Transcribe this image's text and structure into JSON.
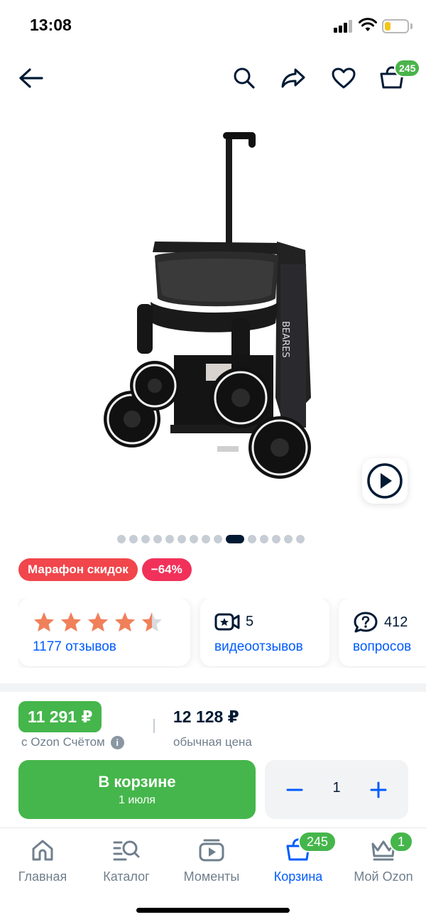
{
  "status_bar": {
    "time": "13:08",
    "battery_level": 0.25,
    "battery_color": "#f5c518"
  },
  "nav": {
    "back_icon": "arrow-left-icon",
    "icons": [
      "search-icon",
      "share-icon",
      "heart-icon",
      "cart-icon"
    ],
    "cart_count": "245"
  },
  "product": {
    "image": "folded black stroller",
    "brand_text": "BEARES",
    "video_icon": "play-icon"
  },
  "gallery": {
    "total_dots": 15,
    "active_index": 9
  },
  "badges": {
    "marathon": "Марафон скидок",
    "discount": "−64%"
  },
  "cards": {
    "rating": {
      "stars": 4.5,
      "label": "1177 отзывов",
      "star_color": "#f0805a"
    },
    "videos": {
      "count": "5",
      "label": "видеоотзывов"
    },
    "questions": {
      "count": "412",
      "label": "вопросов"
    }
  },
  "price": {
    "card_price": "11 291 ₽",
    "card_label": "с Ozon Счётом",
    "regular_price": "12 128 ₽",
    "regular_label": "обычная цена"
  },
  "cart_button": {
    "title": "В корзине",
    "subtitle": "1 июля"
  },
  "quantity": {
    "value": "1"
  },
  "tabbar": {
    "items": [
      {
        "label": "Главная",
        "icon": "home-icon"
      },
      {
        "label": "Каталог",
        "icon": "catalog-icon"
      },
      {
        "label": "Моменты",
        "icon": "moments-icon"
      },
      {
        "label": "Корзина",
        "icon": "cart-icon",
        "badge": "245",
        "active": true
      },
      {
        "label": "Мой Ozon",
        "icon": "crown-icon",
        "badge": "1"
      }
    ]
  },
  "colors": {
    "brand_blue": "#005bff",
    "green": "#45b64b",
    "text": "#001a34",
    "muted": "#707f8d"
  }
}
